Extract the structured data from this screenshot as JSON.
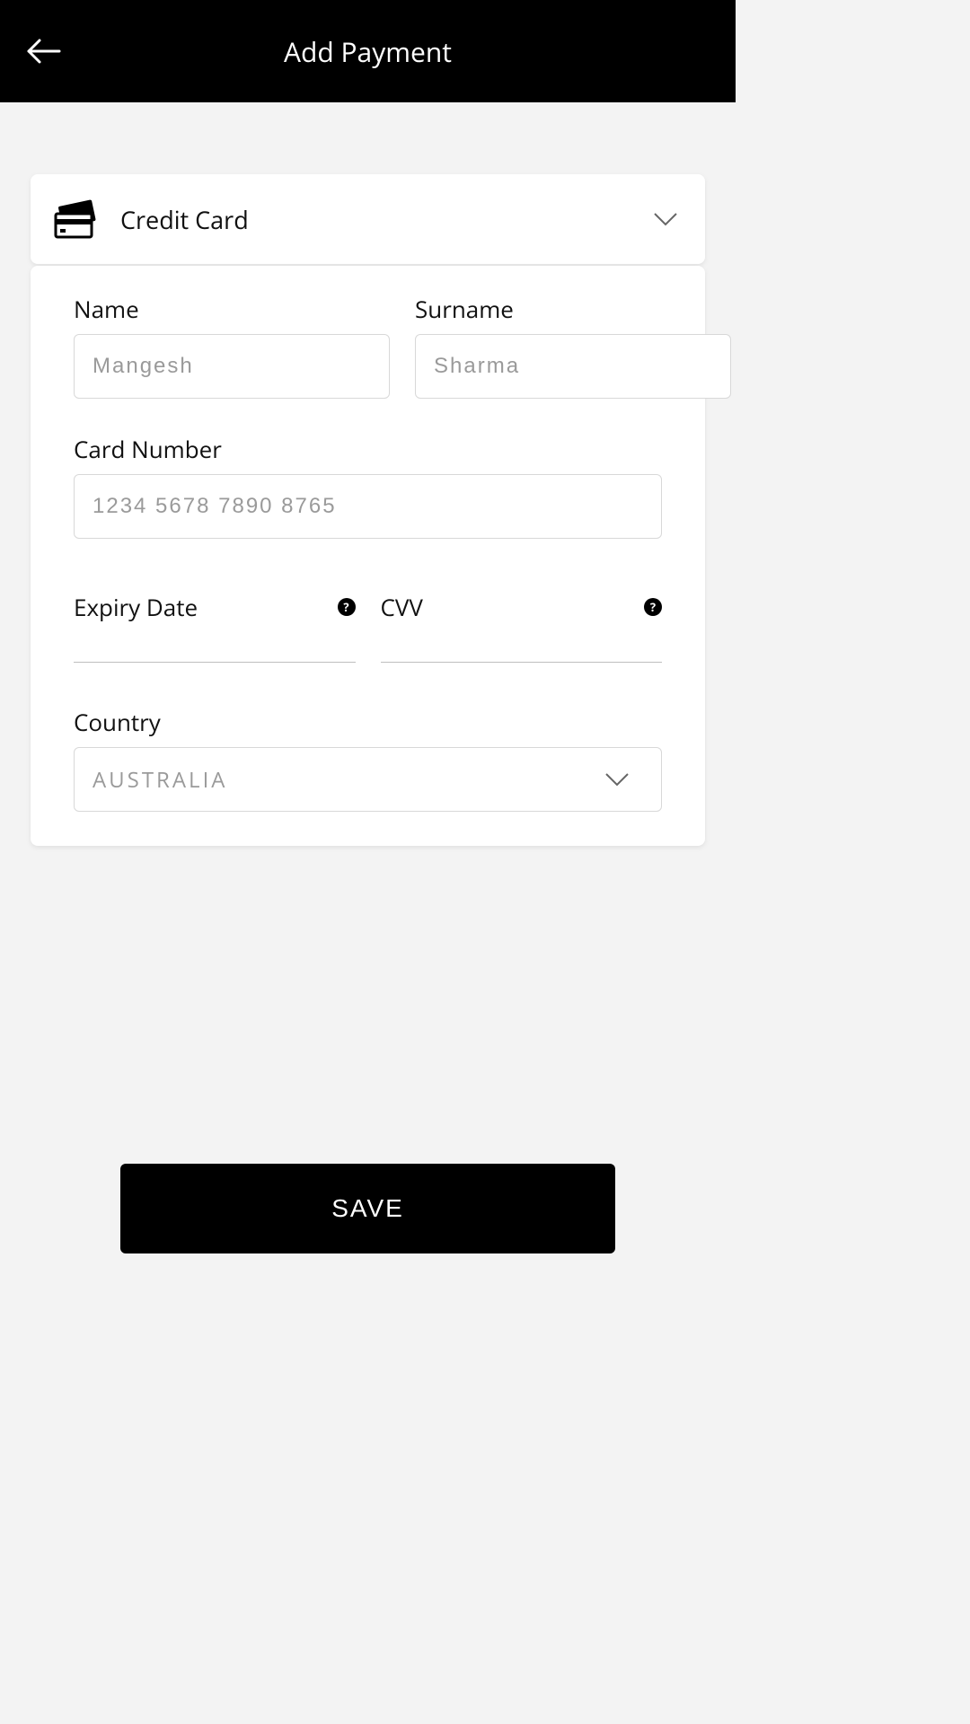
{
  "header": {
    "title": "Add Payment"
  },
  "method": {
    "label": "Credit Card"
  },
  "form": {
    "name": {
      "label": "Name",
      "placeholder": "Mangesh",
      "value": ""
    },
    "surname": {
      "label": "Surname",
      "placeholder": "Sharma",
      "value": ""
    },
    "card_number": {
      "label": "Card Number",
      "placeholder": "1234 5678 7890 8765",
      "value": ""
    },
    "expiry": {
      "label": "Expiry Date",
      "value": ""
    },
    "cvv": {
      "label": "CVV",
      "value": ""
    },
    "country": {
      "label": "Country",
      "selected": "AUSTRALIA"
    }
  },
  "actions": {
    "save": "SAVE"
  }
}
